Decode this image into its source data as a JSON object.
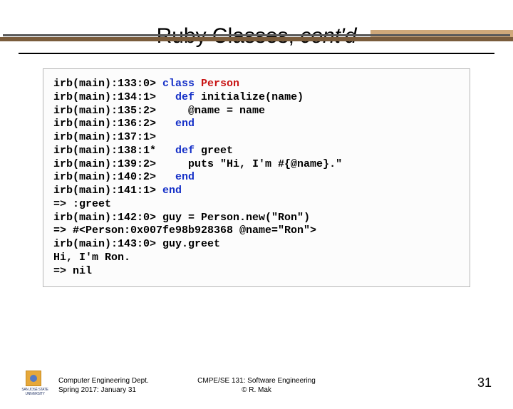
{
  "title": {
    "main": "Ruby Classes, ",
    "italic": "cont'd"
  },
  "code": {
    "l1": {
      "prompt": "irb(main):133:0> ",
      "kw1": "class ",
      "red": "Person"
    },
    "l2": {
      "prompt": "irb(main):134:1>   ",
      "kw1": "def ",
      "rest": "initialize(name)"
    },
    "l3": {
      "prompt": "irb(main):135:2>     ",
      "rest": "@name = name"
    },
    "l4": {
      "prompt": "irb(main):136:2>   ",
      "kw1": "end"
    },
    "l5": {
      "prompt": "irb(main):137:1>"
    },
    "l6": {
      "prompt": "irb(main):138:1*   ",
      "kw1": "def ",
      "rest": "greet"
    },
    "l7": {
      "prompt": "irb(main):139:2>     ",
      "rest": "puts \"Hi, I'm #{@name}.\""
    },
    "l8": {
      "prompt": "irb(main):140:2>   ",
      "kw1": "end"
    },
    "l9": {
      "prompt": "irb(main):141:1> ",
      "kw1": "end"
    },
    "l10": {
      "rest": "=> :greet"
    },
    "l11": {
      "prompt": "irb(main):142:0> ",
      "rest": "guy = Person.new(\"Ron\")"
    },
    "l12": {
      "rest": "=> #<Person:0x007fe98b928368 @name=\"Ron\">"
    },
    "l13": {
      "prompt": "irb(main):143:0> ",
      "rest": "guy.greet"
    },
    "l14": {
      "rest": "Hi, I'm Ron."
    },
    "l15": {
      "rest": "=> nil"
    }
  },
  "footer": {
    "left_line1": "Computer Engineering Dept.",
    "left_line2": "Spring 2017: January 31",
    "mid_line1": "CMPE/SE 131: Software Engineering",
    "mid_line2": "© R. Mak",
    "page": "31",
    "logo_text": "SAN JOSÉ STATE UNIVERSITY"
  }
}
